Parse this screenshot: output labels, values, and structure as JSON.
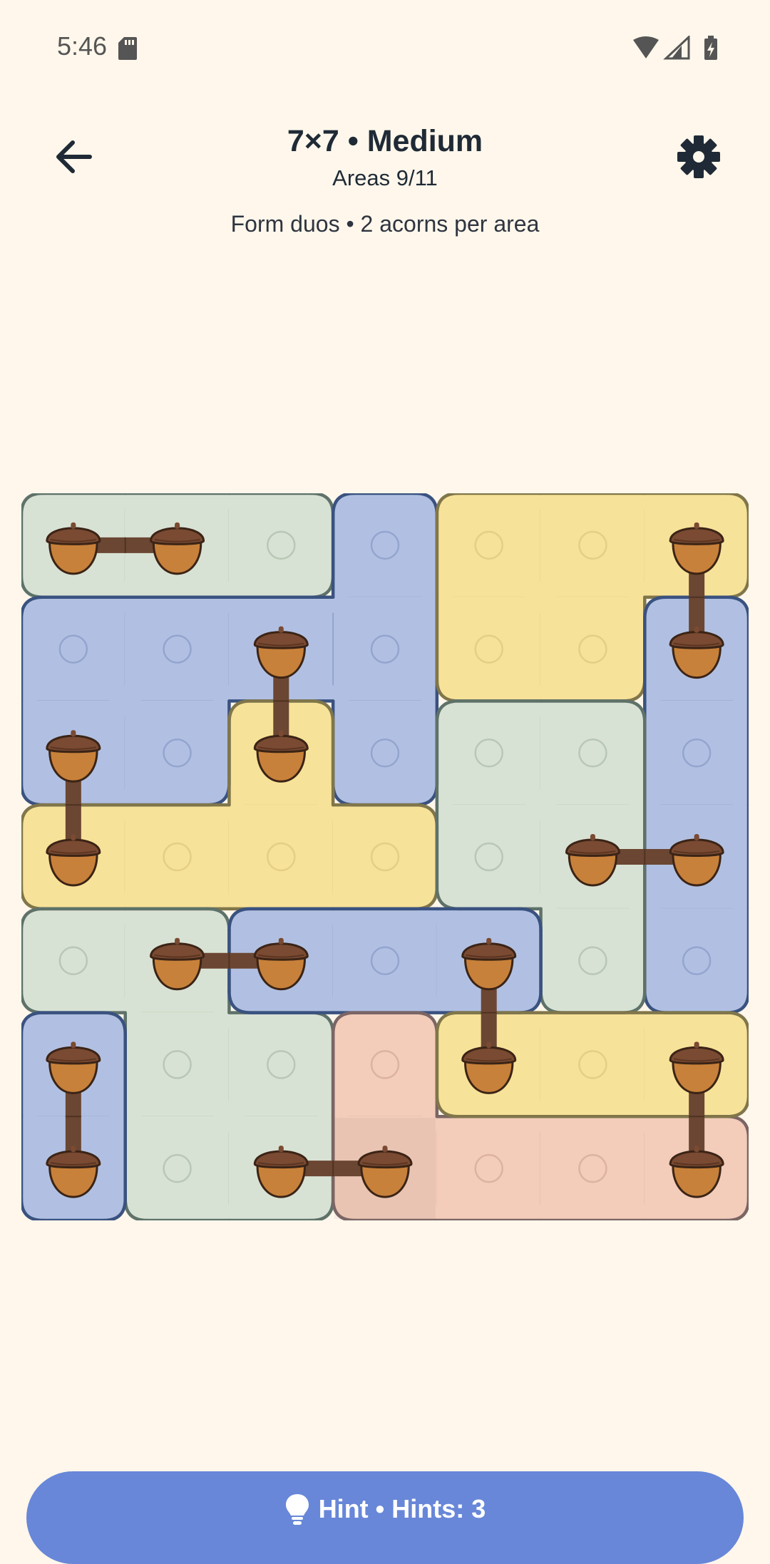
{
  "status_bar": {
    "time": "5:46"
  },
  "header": {
    "title": "7×7 • Medium",
    "subtitle": "Areas 9/11",
    "instructions": "Form duos • 2 acorns per area"
  },
  "hint_button": {
    "label": "Hint • Hints: 3"
  },
  "board": {
    "rows": 7,
    "cols": 7,
    "colors": {
      "green": {
        "fill": "#D8E2D4",
        "border": "#5E7269",
        "line": "#B9C7B6"
      },
      "blue": {
        "fill": "#B1C0E2",
        "border": "#3A5280",
        "line": "#93A5CF"
      },
      "yellow": {
        "fill": "#F7E299",
        "border": "#80764A",
        "line": "#E5CF86"
      },
      "pink": {
        "fill": "#F3CCBA",
        "border": "#7B6565",
        "line": "#DDB2A0"
      }
    },
    "areas": [
      {
        "color": "green",
        "cells": [
          [
            0,
            0
          ],
          [
            0,
            1
          ],
          [
            0,
            2
          ]
        ]
      },
      {
        "color": "blue",
        "cells": [
          [
            0,
            3
          ],
          [
            1,
            3
          ],
          [
            2,
            3
          ],
          [
            1,
            0
          ],
          [
            1,
            1
          ],
          [
            1,
            2
          ],
          [
            2,
            0
          ],
          [
            2,
            1
          ]
        ]
      },
      {
        "color": "yellow",
        "cells": [
          [
            0,
            4
          ],
          [
            0,
            5
          ],
          [
            0,
            6
          ],
          [
            1,
            4
          ],
          [
            1,
            5
          ]
        ]
      },
      {
        "color": "blue",
        "cells": [
          [
            1,
            6
          ],
          [
            2,
            6
          ],
          [
            3,
            6
          ],
          [
            4,
            6
          ]
        ]
      },
      {
        "color": "yellow",
        "cells": [
          [
            2,
            2
          ],
          [
            3,
            0
          ],
          [
            3,
            1
          ],
          [
            3,
            2
          ],
          [
            3,
            3
          ]
        ]
      },
      {
        "color": "green",
        "cells": [
          [
            2,
            4
          ],
          [
            2,
            5
          ],
          [
            3,
            4
          ],
          [
            3,
            5
          ],
          [
            4,
            5
          ]
        ]
      },
      {
        "color": "green",
        "cells": [
          [
            4,
            0
          ],
          [
            4,
            1
          ],
          [
            5,
            1
          ],
          [
            5,
            2
          ],
          [
            6,
            1
          ],
          [
            6,
            2
          ]
        ]
      },
      {
        "color": "blue",
        "cells": [
          [
            4,
            2
          ],
          [
            4,
            3
          ],
          [
            4,
            4
          ]
        ]
      },
      {
        "color": "blue",
        "cells": [
          [
            5,
            0
          ],
          [
            6,
            0
          ]
        ]
      },
      {
        "color": "pink",
        "cells": [
          [
            5,
            3
          ],
          [
            6,
            3
          ],
          [
            6,
            4
          ],
          [
            6,
            5
          ],
          [
            6,
            6
          ]
        ]
      },
      {
        "color": "yellow",
        "cells": [
          [
            5,
            4
          ],
          [
            5,
            5
          ],
          [
            5,
            6
          ]
        ]
      }
    ],
    "acorns": [
      [
        0,
        0
      ],
      [
        0,
        1
      ],
      [
        0,
        6
      ],
      [
        1,
        2
      ],
      [
        1,
        6
      ],
      [
        2,
        0
      ],
      [
        2,
        2
      ],
      [
        3,
        0
      ],
      [
        3,
        5
      ],
      [
        3,
        6
      ],
      [
        4,
        1
      ],
      [
        4,
        2
      ],
      [
        4,
        4
      ],
      [
        5,
        0
      ],
      [
        5,
        4
      ],
      [
        5,
        6
      ],
      [
        6,
        0
      ],
      [
        6,
        2
      ],
      [
        6,
        3
      ],
      [
        6,
        6
      ]
    ],
    "links": [
      [
        [
          0,
          0
        ],
        [
          0,
          1
        ]
      ],
      [
        [
          0,
          6
        ],
        [
          1,
          6
        ]
      ],
      [
        [
          1,
          2
        ],
        [
          2,
          2
        ]
      ],
      [
        [
          2,
          0
        ],
        [
          3,
          0
        ]
      ],
      [
        [
          3,
          5
        ],
        [
          3,
          6
        ]
      ],
      [
        [
          4,
          1
        ],
        [
          4,
          2
        ]
      ],
      [
        [
          4,
          4
        ],
        [
          5,
          4
        ]
      ],
      [
        [
          5,
          0
        ],
        [
          6,
          0
        ]
      ],
      [
        [
          5,
          6
        ],
        [
          6,
          6
        ]
      ],
      [
        [
          6,
          2
        ],
        [
          6,
          3
        ]
      ]
    ],
    "shaded_cells": [
      [
        6,
        3
      ]
    ],
    "acorn_colors": {
      "body": "#C8813A",
      "cap": "#7A4A32",
      "outline": "#3B2416",
      "link": "#6B4632"
    }
  }
}
